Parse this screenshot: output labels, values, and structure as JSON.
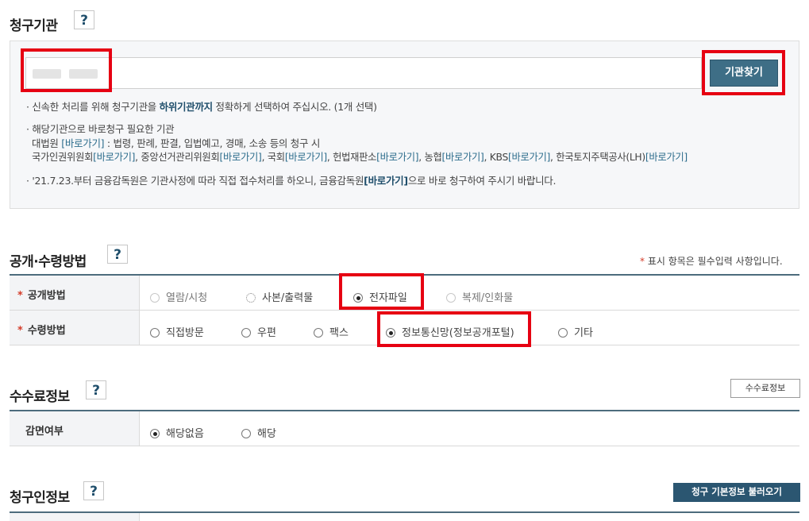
{
  "sections": {
    "agency": {
      "title": "청구기관",
      "help": "?",
      "find_button": "기관찾기",
      "notes": {
        "n1_pre": "· 신속한 처리를 위해 청구기관을 ",
        "n1_bold": "하위기관까지",
        "n1_post": " 정확하게 선택하여 주십시오. (1개 선택)",
        "n2_line1": "· 해당기관으로 바로청구 필요한 기관",
        "n2_line2_pre": "대법원 ",
        "n2_line2_link": "[바로가기]",
        "n2_line2_post": " : 법령, 판례, 판결, 입법예고, 경매, 소송 등의 청구 시",
        "n2_line3": [
          {
            "name": "국가인권위원회",
            "link": "[바로가기]",
            "sep": ", "
          },
          {
            "name": "중앙선거관리위원회",
            "link": "[바로가기]",
            "sep": ", "
          },
          {
            "name": "국회",
            "link": "[바로가기]",
            "sep": ", "
          },
          {
            "name": "헌법재판소",
            "link": "[바로가기]",
            "sep": ", "
          },
          {
            "name": "농협",
            "link": "[바로가기]",
            "sep": ", "
          },
          {
            "name": "KBS",
            "link": "[바로가기]",
            "sep": ", "
          },
          {
            "name": "한국토지주택공사(LH)",
            "link": "[바로가기]",
            "sep": ""
          }
        ],
        "n3_pre": "· '21.7.23.부터 금융감독원은 기관사정에 따라 직접 접수처리를 하오니, 금융감독원",
        "n3_link": "[바로가기]",
        "n3_post": "으로 바로 청구하여 주시기 바랍니다."
      }
    },
    "method": {
      "title": "공개·수령방법",
      "help": "?",
      "required_note_star": "*",
      "required_note": " 표시 항목은 필수입력 사항입니다.",
      "disclosure": {
        "label": "공개방법",
        "star": "*",
        "options": [
          "열람/시청",
          "사본/출력물",
          "전자파일",
          "복제/인화물"
        ],
        "selected": "전자파일"
      },
      "receipt": {
        "label": "수령방법",
        "star": "*",
        "options": [
          "직접방문",
          "우편",
          "팩스",
          "정보통신망(정보공개포털)",
          "기타"
        ],
        "selected": "정보통신망(정보공개포털)"
      }
    },
    "fee": {
      "title": "수수료정보",
      "help": "?",
      "button": "수수료정보",
      "exempt": {
        "label": "감면여부",
        "options": [
          "해당없음",
          "해당"
        ],
        "selected": "해당없음"
      }
    },
    "claimant": {
      "title": "청구인정보",
      "help": "?",
      "button": "청구 기본정보 불러오기"
    }
  },
  "colors": {
    "highlight_red": "#e60012",
    "primary_button": "#3e6e86",
    "dark_button": "#2b5671",
    "link": "#2c6c8c"
  }
}
